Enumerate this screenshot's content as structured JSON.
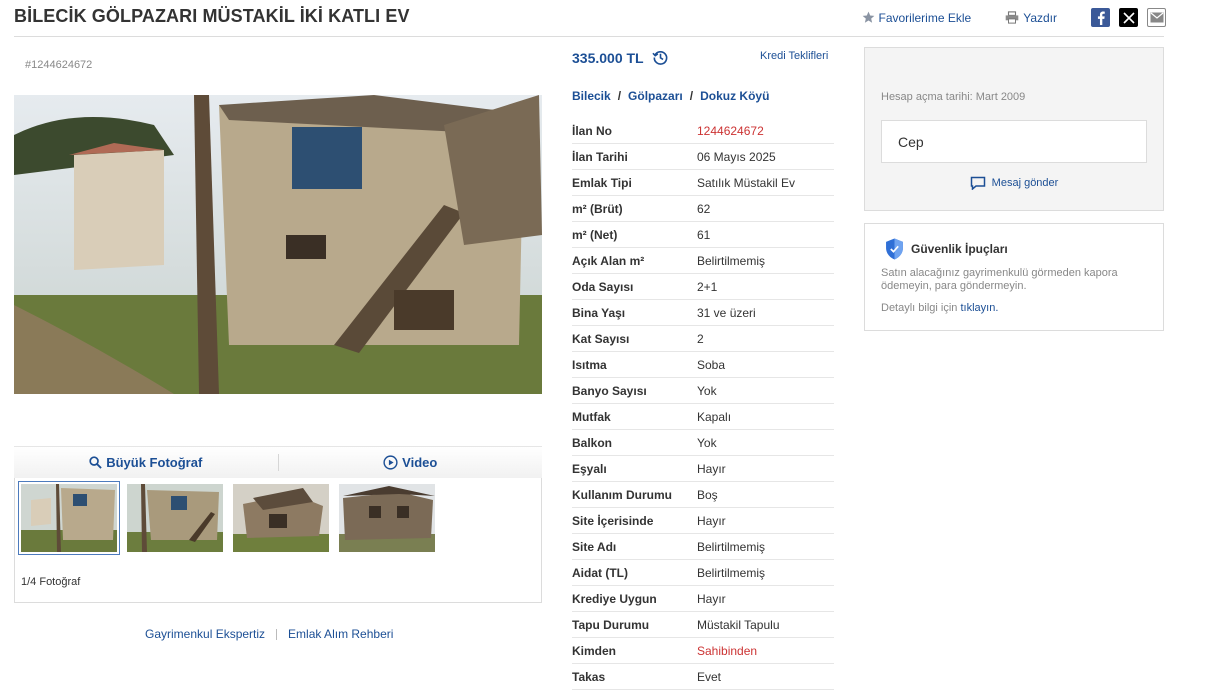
{
  "header": {
    "title": "BİLECİK GÖLPAZARI MÜSTAKİL İKİ KATLI EV",
    "favorites_label": "Favorilerime Ekle",
    "print_label": "Yazdır"
  },
  "gallery": {
    "listing_id": "#1244624672",
    "big_photo_label": "Büyük Fotoğraf",
    "video_label": "Video",
    "photo_count": "1/4 Fotoğraf"
  },
  "bottom_links": {
    "appraisal": "Gayrimenkul Ekspertiz",
    "guide": "Emlak Alım Rehberi"
  },
  "listing": {
    "price": "335.000 TL",
    "credit_label": "Kredi Teklifleri",
    "breadcrumb": [
      "Bilecik",
      "Gölpazarı",
      "Dokuz Köyü"
    ],
    "details": [
      {
        "key": "İlan No",
        "value": "1244624672"
      },
      {
        "key": "İlan Tarihi",
        "value": "06 Mayıs 2025"
      },
      {
        "key": "Emlak Tipi",
        "value": "Satılık Müstakil Ev"
      },
      {
        "key": "m² (Brüt)",
        "value": "62"
      },
      {
        "key": "m² (Net)",
        "value": "61"
      },
      {
        "key": "Açık Alan m²",
        "value": "Belirtilmemiş"
      },
      {
        "key": "Oda Sayısı",
        "value": "2+1"
      },
      {
        "key": "Bina Yaşı",
        "value": "31 ve üzeri"
      },
      {
        "key": "Kat Sayısı",
        "value": "2"
      },
      {
        "key": "Isıtma",
        "value": "Soba"
      },
      {
        "key": "Banyo Sayısı",
        "value": "Yok"
      },
      {
        "key": "Mutfak",
        "value": "Kapalı"
      },
      {
        "key": "Balkon",
        "value": "Yok"
      },
      {
        "key": "Eşyalı",
        "value": "Hayır"
      },
      {
        "key": "Kullanım Durumu",
        "value": "Boş"
      },
      {
        "key": "Site İçerisinde",
        "value": "Hayır"
      },
      {
        "key": "Site Adı",
        "value": "Belirtilmemiş"
      },
      {
        "key": "Aidat (TL)",
        "value": "Belirtilmemiş"
      },
      {
        "key": "Krediye Uygun",
        "value": "Hayır"
      },
      {
        "key": "Tapu Durumu",
        "value": "Müstakil Tapulu"
      },
      {
        "key": "Kimden",
        "value": "Sahibinden"
      },
      {
        "key": "Takas",
        "value": "Evet"
      }
    ]
  },
  "seller": {
    "account_date": "Hesap açma tarihi: Mart 2009",
    "phone_label": "Cep",
    "message_label": "Mesaj gönder"
  },
  "safety": {
    "title": "Güvenlik İpuçları",
    "text": "Satın alacağınız gayrimenkulü görmeden kapora ödemeyin, para göndermeyin.",
    "more_prefix": "Detaylı bilgi için",
    "more_link": "tıklayın."
  },
  "colors": {
    "link_blue": "#1c4f95",
    "highlight_red": "#cc3333",
    "shield_blue": "#2f6fd6"
  }
}
